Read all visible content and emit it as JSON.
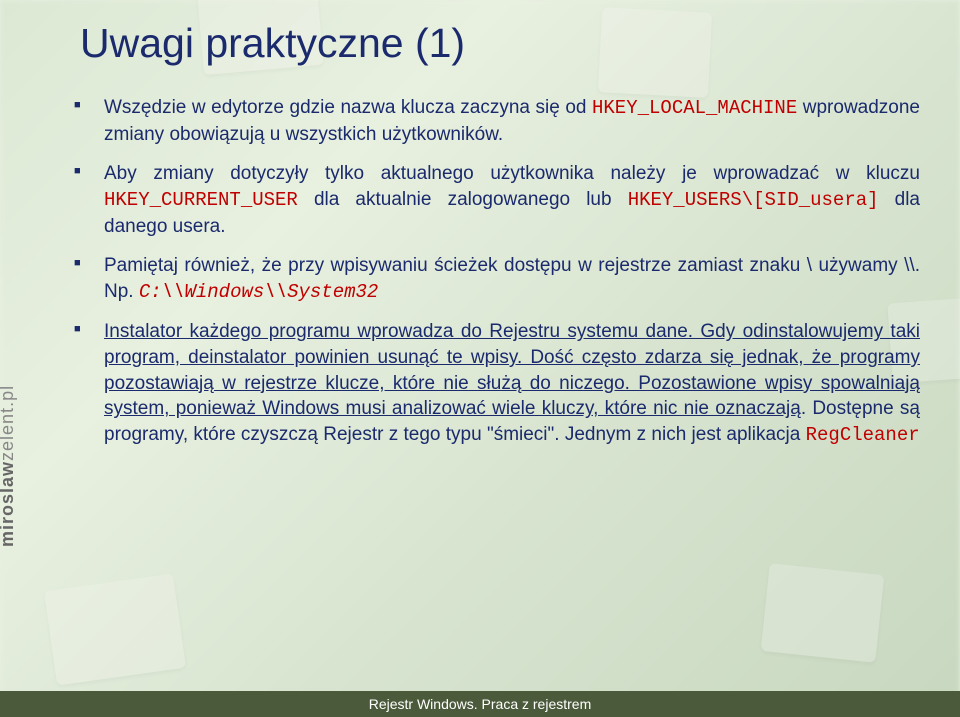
{
  "title": "Uwagi praktyczne (1)",
  "sidebar": {
    "prefix": "miroslaw",
    "suffix": "zelent.pl"
  },
  "bullets": [
    {
      "pre": "Wszędzie w edytorze gdzie nazwa klucza zaczyna się od ",
      "code1": "HKEY_LOCAL_MACHINE",
      "post": " wprowadzone zmiany obowiązują u wszystkich użytkowników."
    },
    {
      "pre": "Aby zmiany dotyczyły tylko aktualnego użytkownika należy je wprowadzać w kluczu ",
      "code1": "HKEY_CURRENT_USER",
      "mid": " dla aktualnie zalogowanego lub ",
      "code2": "HKEY_USERS\\[SID_usera]",
      "post": " dla danego usera."
    },
    {
      "pre": "Pamiętaj również, że przy wpisywaniu ścieżek dostępu w rejestrze zamiast znaku \\ używamy \\\\. Np. ",
      "code1": "C:\\\\Windows\\\\System32"
    },
    {
      "pre": "Instalator każdego programu wprowadza do Rejestru systemu dane. Gdy odinstalowujemy taki program, deinstalator powinien usunąć te wpisy. Dość często zdarza się jednak, że programy pozostawiają w rejestrze klucze, które nie służą do niczego. Pozostawione wpisy spowalniają system, ponieważ Windows musi analizować wiele kluczy, które nic nie oznaczają",
      "post_noul": ". Dostępne są programy, które czyszczą Rejestr z tego typu \"śmieci\". Jednym z nich jest aplikacja ",
      "code1": "RegCleaner"
    }
  ],
  "footer": "Rejestr Windows. Praca z rejestrem"
}
